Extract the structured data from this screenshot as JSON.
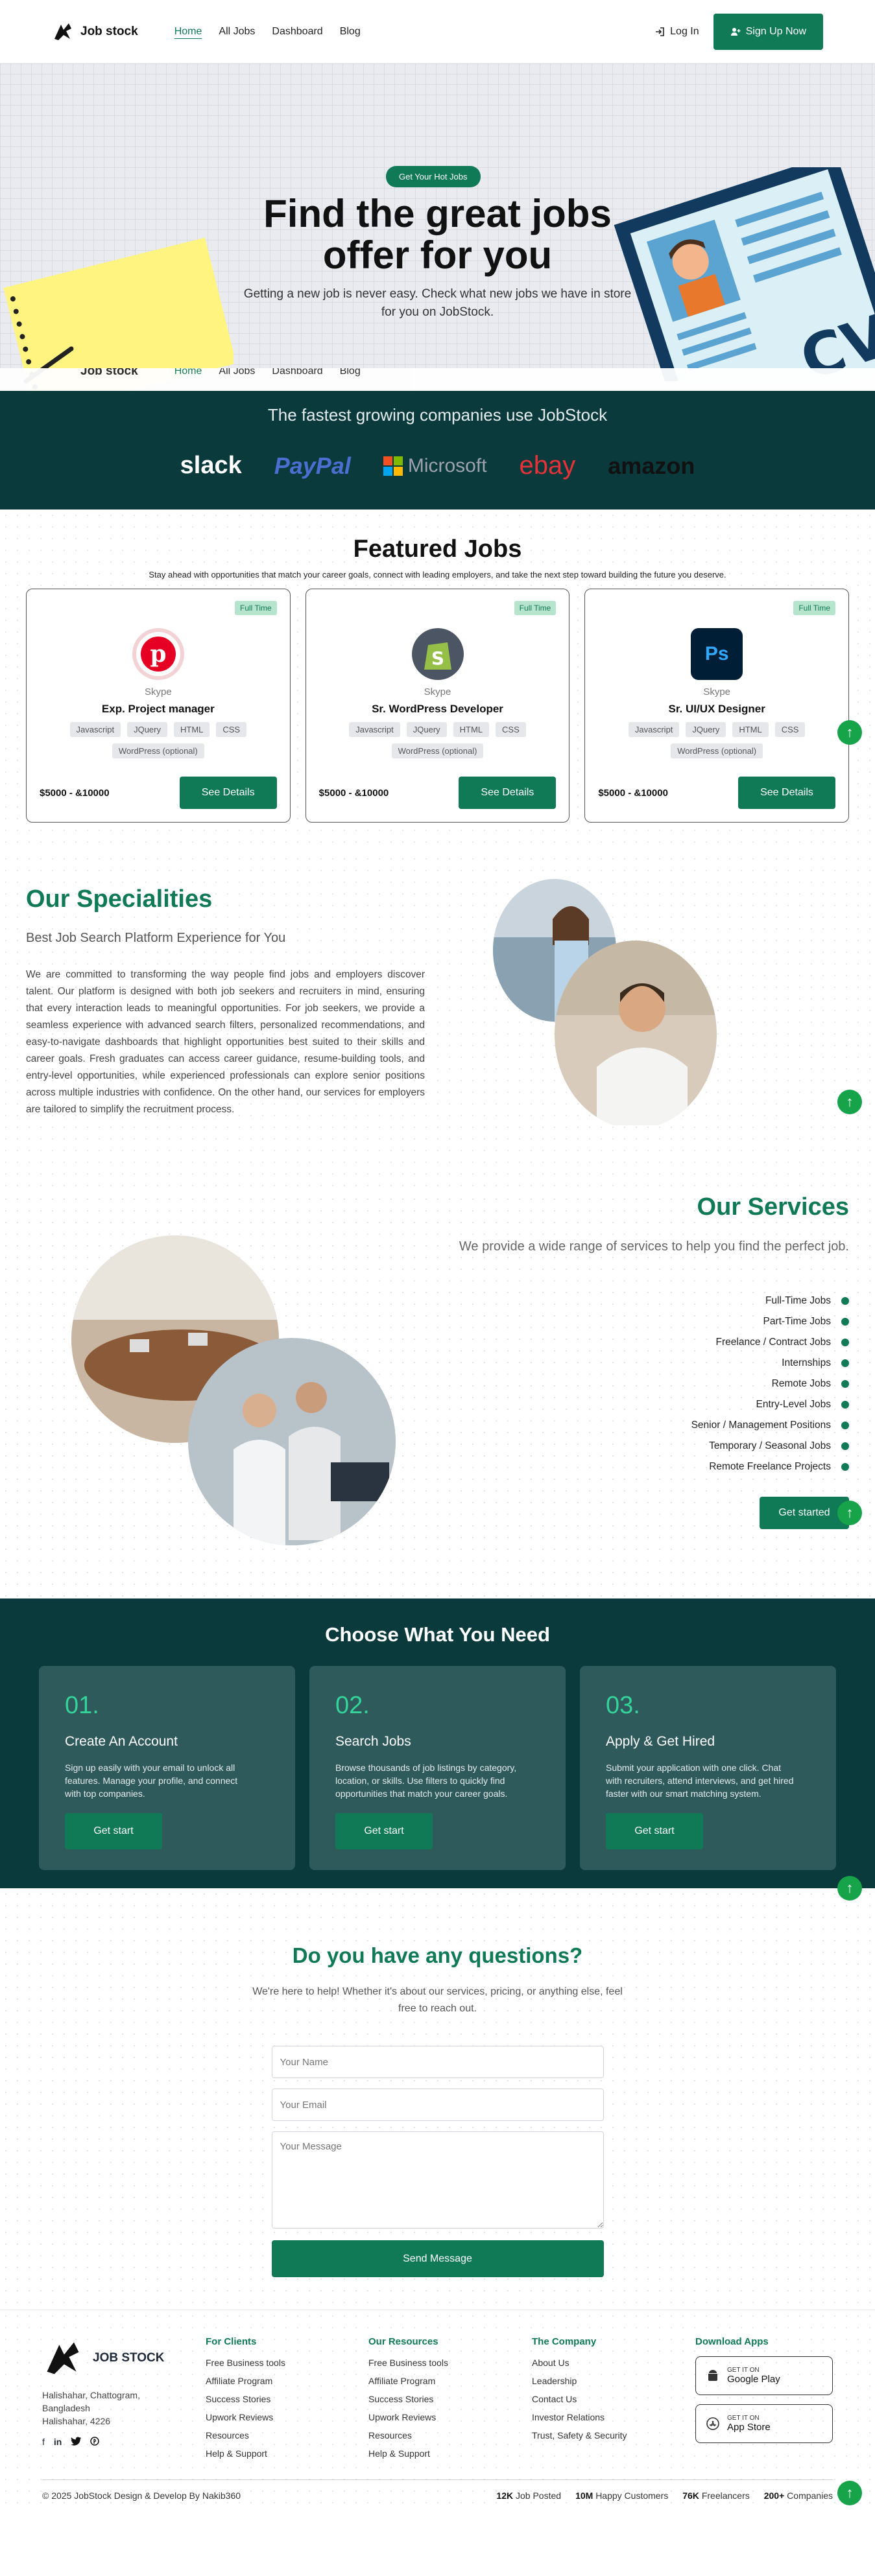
{
  "nav": {
    "logo_text": "Job stock",
    "links": [
      "Home",
      "All Jobs",
      "Dashboard",
      "Blog"
    ],
    "login": "Log In",
    "signup": "Sign Up Now"
  },
  "hero": {
    "badge": "Get Your Hot Jobs",
    "title_line1": "Find the great jobs",
    "title_line2": "offer for you",
    "subtitle": "Getting a new job is never easy. Check what new jobs we have in store for you on JobStock."
  },
  "companies": {
    "heading": "The fastest growing companies use JobStock",
    "brands": [
      {
        "name": "slack",
        "color": "#1e1e1e"
      },
      {
        "name": "PayPal",
        "color": "#253b80"
      },
      {
        "name": "Microsoft",
        "color": "#737373"
      },
      {
        "name": "ebay",
        "color": "#e53238"
      },
      {
        "name": "amazon",
        "color": "#111111"
      }
    ]
  },
  "featured": {
    "title": "Featured Jobs",
    "subtitle": "Stay ahead with opportunities that match your career goals, connect with leading employers, and take the next step toward building the future you deserve.",
    "jobs": [
      {
        "type": "Full Time",
        "company": "Skype",
        "role": "Exp. Project manager",
        "skills": [
          "Javascript",
          "JQuery",
          "HTML",
          "CSS",
          "WordPress (optional)"
        ],
        "salary": "$5000 - &10000",
        "button": "See Details",
        "logo": "pinterest-logo",
        "logo_color": "#e60023"
      },
      {
        "type": "Full Time",
        "company": "Skype",
        "role": "Sr. WordPress Developer",
        "skills": [
          "Javascript",
          "JQuery",
          "HTML",
          "CSS",
          "WordPress (optional)"
        ],
        "salary": "$5000 - &10000",
        "button": "See Details",
        "logo": "shopify-logo",
        "logo_color": "#5e8e3e"
      },
      {
        "type": "Full Time",
        "company": "Skype",
        "role": "Sr. UI/UX Designer",
        "skills": [
          "Javascript",
          "JQuery",
          "HTML",
          "CSS",
          "WordPress (optional)"
        ],
        "salary": "$5000 - &10000",
        "button": "See Details",
        "logo": "photoshop-logo",
        "logo_color": "#001e36"
      }
    ]
  },
  "specialities": {
    "title": "Our Specialities",
    "subtitle": "Best Job Search Platform Experience for You",
    "body": "We are committed to transforming the way people find jobs and employers discover talent. Our platform is designed with both job seekers and recruiters in mind, ensuring that every interaction leads to meaningful opportunities. For job seekers, we provide a seamless experience with advanced search filters, personalized recommendations, and easy-to-navigate dashboards that highlight opportunities best suited to their skills and career goals. Fresh graduates can access career guidance, resume-building tools, and entry-level opportunities, while experienced professionals can explore senior positions across multiple industries with confidence. On the other hand, our services for employers are tailored to simplify the recruitment process."
  },
  "services": {
    "title": "Our Services",
    "lead": "We provide a wide range of services to help you find the perfect job.",
    "items": [
      "Full-Time Jobs",
      "Part-Time Jobs",
      "Freelance / Contract Jobs",
      "Internships",
      "Remote Jobs",
      "Entry-Level Jobs",
      "Senior / Management Positions",
      "Temporary / Seasonal Jobs",
      "Remote Freelance Projects"
    ],
    "button": "Get started"
  },
  "choose": {
    "title": "Choose What You Need",
    "steps": [
      {
        "num": "01.",
        "title": "Create An Account",
        "text": "Sign up easily with your email to unlock all features. Manage your profile, and connect with top companies.",
        "button": "Get start"
      },
      {
        "num": "02.",
        "title": "Search Jobs",
        "text": "Browse thousands of job listings by category, location, or skills. Use filters to quickly find opportunities that match your career goals.",
        "button": "Get start"
      },
      {
        "num": "03.",
        "title": "Apply & Get Hired",
        "text": "Submit your application with one click. Chat with recruiters, attend interviews, and get hired faster with our smart matching system.",
        "button": "Get start"
      }
    ]
  },
  "contact": {
    "title": "Do you have any questions?",
    "subtitle": "We're here to help! Whether it's about our services, pricing, or anything else, feel free to reach out.",
    "name_placeholder": "Your Name",
    "email_placeholder": "Your Email",
    "message_placeholder": "Your Message",
    "send": "Send Message"
  },
  "footer": {
    "logo_text": "JOB STOCK",
    "address": [
      "Halishahar, Chattogram,",
      "Bangladesh",
      "Halishahar, 4226"
    ],
    "clients": {
      "title": "For Clients",
      "links": [
        "Free Business tools",
        "Affiliate Program",
        "Success Stories",
        "Upwork Reviews",
        "Resources",
        "Help & Support"
      ]
    },
    "resources": {
      "title": "Our Resources",
      "links": [
        "Free Business tools",
        "Affiliate Program",
        "Success Stories",
        "Upwork Reviews",
        "Resources",
        "Help & Support"
      ]
    },
    "company": {
      "title": "The Company",
      "links": [
        "About Us",
        "Leadership",
        "Contact Us",
        "Investor Relations",
        "Trust, Safety & Security"
      ]
    },
    "apps": {
      "title": "Download Apps",
      "google_small": "GET IT ON",
      "google": "Google Play",
      "apple_small": "GET IT ON",
      "apple": "App Store"
    },
    "copyright": "© 2025 JobStock Design & Develop By Nakib360",
    "stats": [
      {
        "value": "12K",
        "label": "Job Posted"
      },
      {
        "value": "10M",
        "label": "Happy Customers"
      },
      {
        "value": "76K",
        "label": "Freelancers"
      },
      {
        "value": "200+",
        "label": "Companies"
      }
    ]
  }
}
